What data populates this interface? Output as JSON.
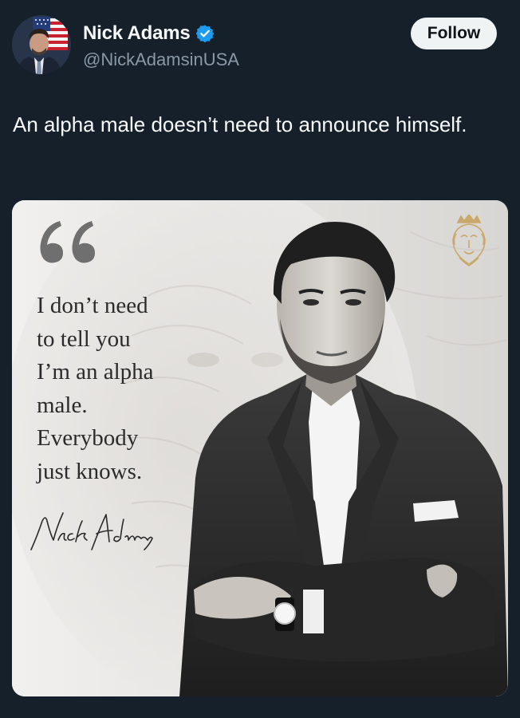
{
  "post": {
    "author": {
      "display_name": "Nick Adams",
      "handle": "@NickAdamsinUSA",
      "verified": true,
      "verified_badge_color": "#1d9bf0"
    },
    "follow_label": "Follow",
    "text": "An alpha male doesn’t need to announce himself.",
    "media": {
      "quote_lines": [
        "I don’t need",
        "to tell you",
        "I’m an alpha",
        "male.",
        "Everybody",
        "just knows."
      ],
      "signature": "Nick Adams",
      "icons": {
        "quote": "quote-mark-icon",
        "crest": "lion-crest-icon"
      }
    }
  },
  "colors": {
    "background": "#15202b",
    "text_primary": "#f7f9f9",
    "text_secondary": "#8b98a5",
    "follow_bg": "#eff3f4",
    "crest_gold": "#c9a86a"
  }
}
